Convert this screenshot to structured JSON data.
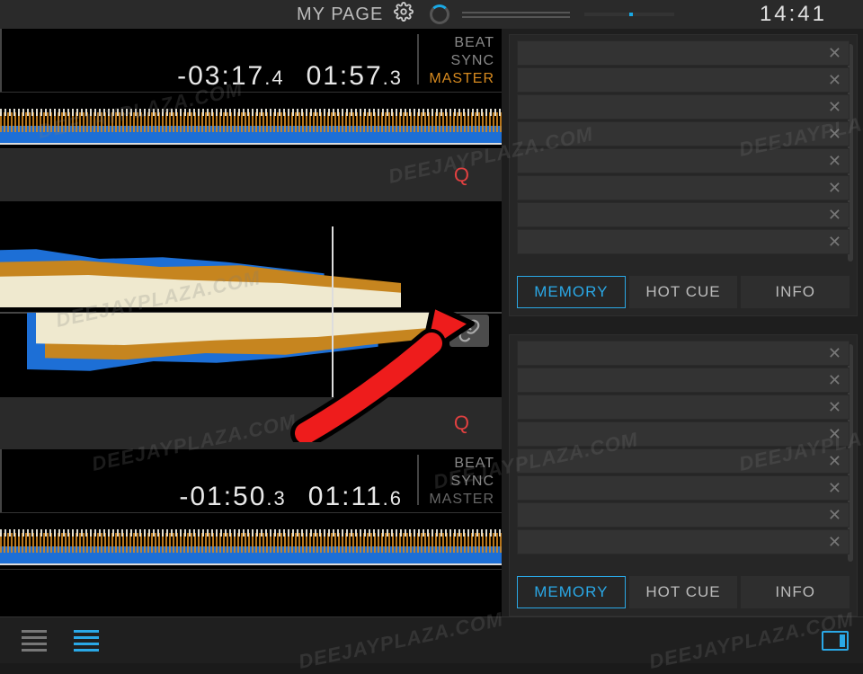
{
  "header": {
    "title": "MY PAGE",
    "clock": "14:41"
  },
  "deck1": {
    "remain": "-03:17",
    "remain_frac": ".4",
    "elapsed": "01:57",
    "elapsed_frac": ".3",
    "sync": {
      "beat": "BEAT",
      "sync": "SYNC",
      "master": "MASTER"
    },
    "q": "Q",
    "master_active": true
  },
  "deck2": {
    "remain": "-01:50",
    "remain_frac": ".3",
    "elapsed": "01:11",
    "elapsed_frac": ".6",
    "sync": {
      "beat": "BEAT",
      "sync": "SYNC",
      "master": "MASTER"
    },
    "q": "Q",
    "master_active": false
  },
  "panel": {
    "slot_count": 8,
    "tabs": {
      "memory": "MEMORY",
      "hotcue": "HOT CUE",
      "info": "INFO"
    },
    "close": "✕"
  },
  "watermark": "DEEJAYPLAZA.COM"
}
